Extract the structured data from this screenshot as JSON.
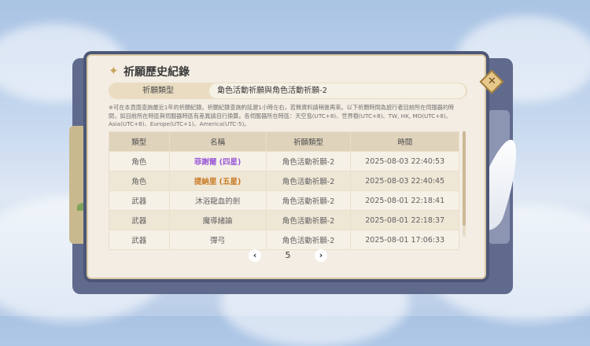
{
  "title": "祈願歷史紀錄",
  "close_label": "✕",
  "filter": {
    "label": "祈願類型",
    "selected": "角色活動祈願與角色活動祈願-2"
  },
  "notice": "※可在本頁面查詢最近1年的祈願紀錄。祈願紀錄查詢約延遲1小時左右，若無資料請稍後再來。以下祈願時間為旅行者目前所在伺服器的時間，如目前所在時區與伺服器時區有差異請自行換算。各伺服器所在時區：天空島(UTC+8)、世界樹(UTC+8)、TW, HK, MO(UTC+8)、Asia(UTC+8)、Europe(UTC+1)、America(UTC-5)。",
  "table": {
    "headers": [
      "類型",
      "名稱",
      "祈願類型",
      "時間"
    ],
    "rows": [
      {
        "type": "角色",
        "name": "菲謝爾 (四星)",
        "banner": "角色活動祈願-2",
        "time": "2025-08-03 22:40:53",
        "rarity": "four"
      },
      {
        "type": "角色",
        "name": "提納里 (五星)",
        "banner": "角色活動祈願-2",
        "time": "2025-08-03 22:40:45",
        "rarity": "five"
      },
      {
        "type": "武器",
        "name": "沐浴龍血的劍",
        "banner": "角色活動祈願-2",
        "time": "2025-08-01 22:18:41",
        "rarity": "three"
      },
      {
        "type": "武器",
        "name": "魔導緒論",
        "banner": "角色活動祈願-2",
        "time": "2025-08-01 22:18:37",
        "rarity": "three"
      },
      {
        "type": "武器",
        "name": "彈弓",
        "banner": "角色活動祈願-2",
        "time": "2025-08-01 17:06:33",
        "rarity": "three"
      }
    ]
  },
  "pagination": {
    "prev": "‹",
    "page": "5",
    "next": "›"
  },
  "colors": {
    "four_star": "#9b5bd6",
    "five_star": "#c97a23"
  }
}
